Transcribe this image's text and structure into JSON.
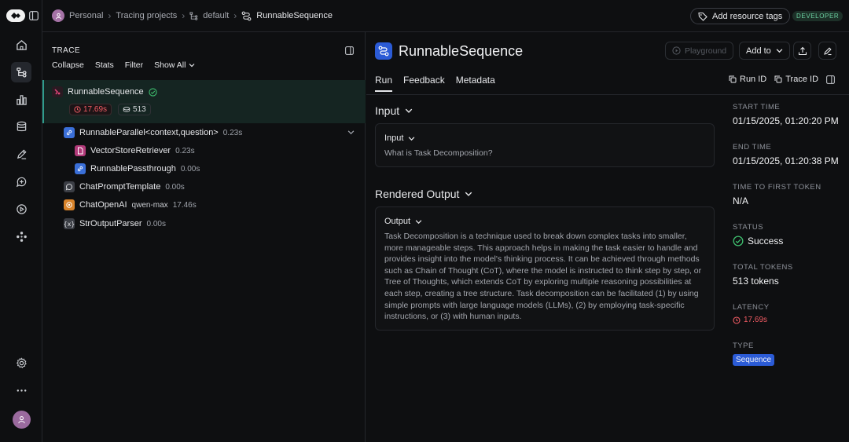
{
  "breadcrumb": {
    "items": [
      "Personal",
      "Tracing projects",
      "default",
      "RunnableSequence"
    ]
  },
  "topbar": {
    "add_resource_tags": "Add resource tags",
    "developer_badge": "DEVELOPER"
  },
  "trace": {
    "title": "TRACE",
    "tools": [
      "Collapse",
      "Stats",
      "Filter",
      "Show All"
    ],
    "root": {
      "name": "RunnableSequence",
      "latency": "17.69s",
      "tokens": "513"
    },
    "items": [
      {
        "name": "RunnableParallel<context,question>",
        "meta": "0.23s",
        "icon": "link-icon",
        "color": "#3a6fd8"
      },
      {
        "name": "VectorStoreRetriever",
        "meta": "0.23s",
        "icon": "document-icon",
        "color": "#b23a7a"
      },
      {
        "name": "RunnablePassthrough",
        "meta": "0.00s",
        "icon": "link-icon",
        "color": "#3a6fd8"
      },
      {
        "name": "ChatPromptTemplate",
        "meta": "0.00s",
        "icon": "chat-icon",
        "color": "#3b3e45"
      },
      {
        "name": "ChatOpenAI",
        "model": "qwen-max",
        "meta": "17.46s",
        "icon": "openai-icon",
        "color": "#d8832a"
      },
      {
        "name": "StrOutputParser",
        "meta": "0.00s",
        "icon": "braces-icon",
        "color": "#3b3e45"
      }
    ]
  },
  "run": {
    "title": "RunnableSequence",
    "playground": "Playground",
    "add_to": "Add to",
    "tabs": [
      "Run",
      "Feedback",
      "Metadata"
    ],
    "run_id": "Run ID",
    "trace_id": "Trace ID",
    "input_section": "Input",
    "input_card_title": "Input",
    "input_text": "What is Task Decomposition?",
    "output_section": "Rendered Output",
    "output_card_title": "Output",
    "output_text": "Task Decomposition is a technique used to break down complex tasks into smaller, more manageable steps. This approach helps in making the task easier to handle and provides insight into the model's thinking process. It can be achieved through methods such as Chain of Thought (CoT), where the model is instructed to think step by step, or Tree of Thoughts, which extends CoT by exploring multiple reasoning possibilities at each step, creating a tree structure. Task decomposition can be facilitated (1) by using simple prompts with large language models (LLMs), (2) by employing task-specific instructions, or (3) with human inputs."
  },
  "info": {
    "start_time_label": "START TIME",
    "start_time": "01/15/2025, 01:20:20 PM",
    "end_time_label": "END TIME",
    "end_time": "01/15/2025, 01:20:38 PM",
    "ttft_label": "TIME TO FIRST TOKEN",
    "ttft": "N/A",
    "status_label": "STATUS",
    "status": "Success",
    "total_tokens_label": "TOTAL TOKENS",
    "total_tokens": "513 tokens",
    "latency_label": "LATENCY",
    "latency": "17.69s",
    "type_label": "TYPE",
    "type": "Sequence"
  },
  "colors": {
    "accent_blue": "#2b5bd6",
    "success_green": "#3fbf6f",
    "latency_red": "#ef5b63",
    "selected_bg": "#152522"
  }
}
